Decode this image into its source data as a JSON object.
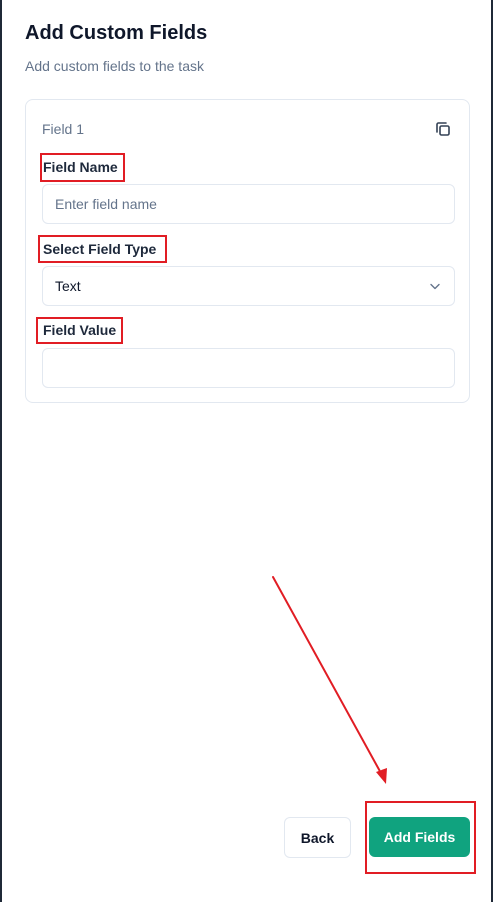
{
  "header": {
    "title": "Add Custom Fields",
    "subtitle": "Add custom fields to the task"
  },
  "card": {
    "title": "Field 1",
    "copy_icon": "copy-icon"
  },
  "fields": {
    "name": {
      "label": "Field Name",
      "value": "",
      "placeholder": "Enter field name"
    },
    "type": {
      "label": "Select Field Type",
      "selected": "Text",
      "icon": "chevron-down-icon"
    },
    "value": {
      "label": "Field Value",
      "value": "",
      "placeholder": ""
    }
  },
  "footer": {
    "back_label": "Back",
    "add_label": "Add Fields"
  },
  "colors": {
    "primary": "#10a37f",
    "annotation": "#e11d24",
    "muted_text": "#64748b",
    "border": "#e2e8f0"
  }
}
